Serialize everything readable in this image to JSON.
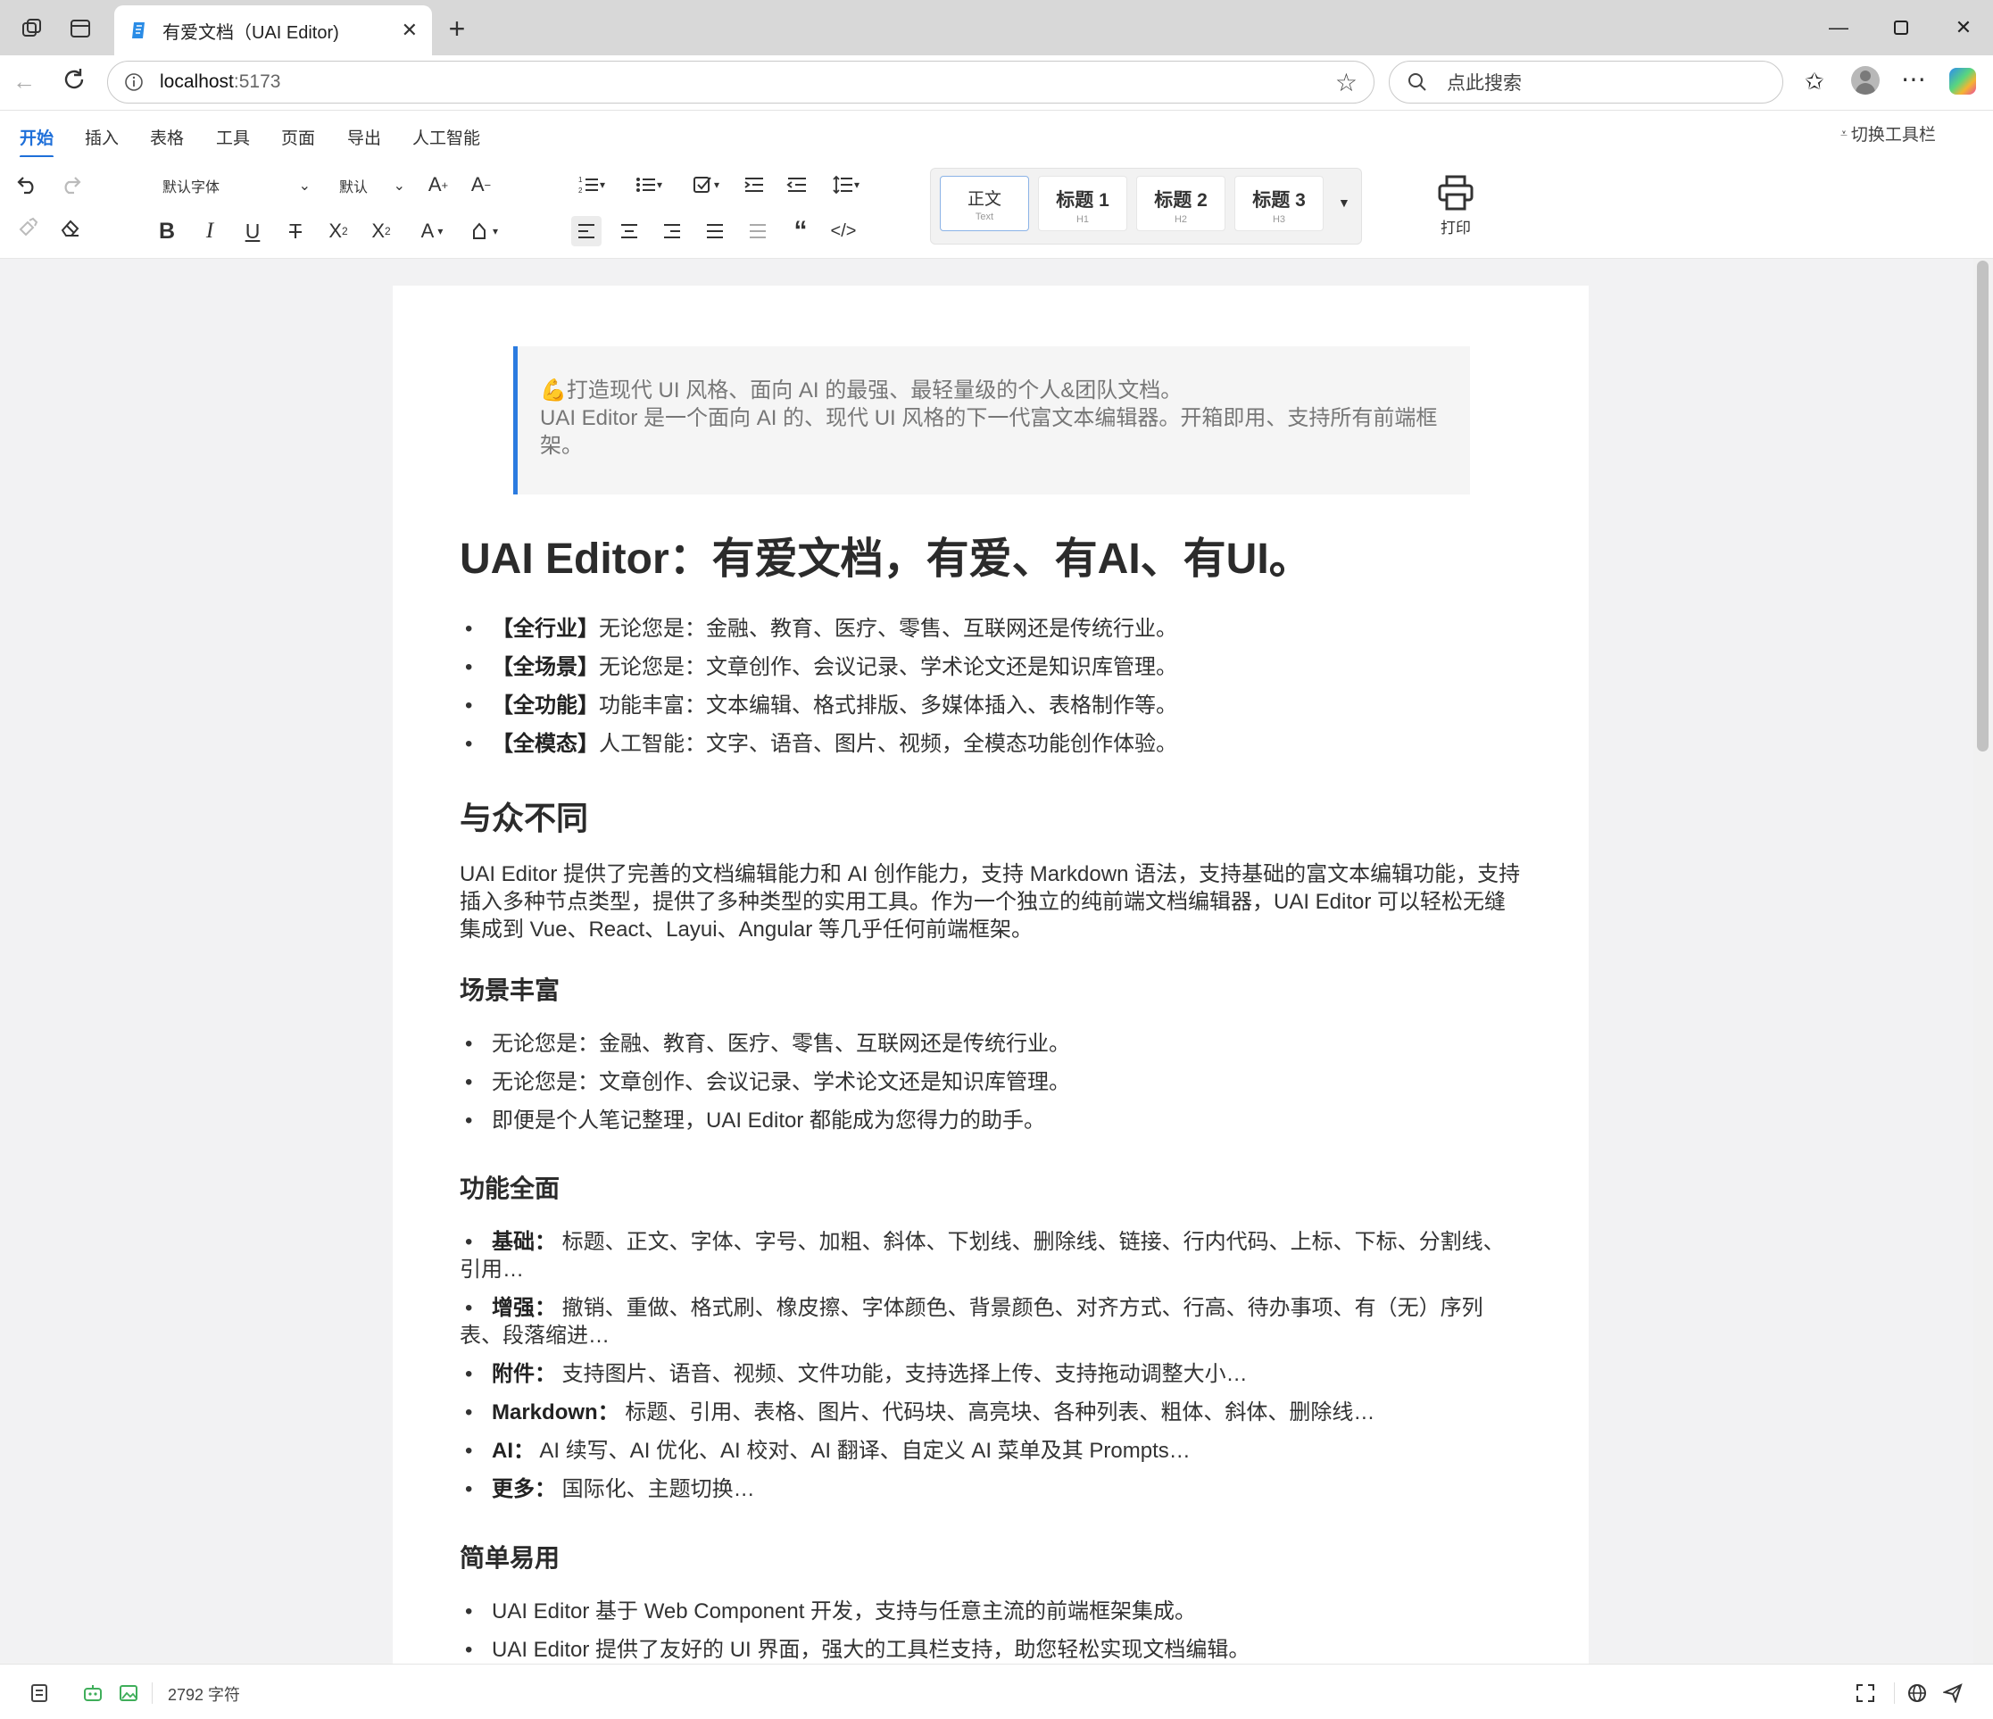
{
  "browser": {
    "tab_title": "有爱文档（UAI Editor)",
    "url_host": "localhost",
    "url_port": ":5173",
    "search_placeholder": "点此搜索",
    "new_tab": "+"
  },
  "editor": {
    "menus": [
      "开始",
      "插入",
      "表格",
      "工具",
      "页面",
      "导出",
      "人工智能"
    ],
    "toggle_toolbar": "切换工具栏",
    "font_family": "默认字体",
    "font_size": "默认",
    "headings": [
      {
        "label": "正文",
        "sub": "Text"
      },
      {
        "label": "标题 1",
        "sub": "H1"
      },
      {
        "label": "标题 2",
        "sub": "H2"
      },
      {
        "label": "标题 3",
        "sub": "H3"
      }
    ],
    "print": "打印",
    "accent": "#1e6fd9"
  },
  "doc": {
    "quote_line1": "💪打造现代 UI 风格、面向 AI 的最强、最轻量级的个人&团队文档。",
    "quote_line2": "UAI Editor 是一个面向 AI 的、现代 UI 风格的下一代富文本编辑器。开箱即用、支持所有前端框",
    "quote_line3": "架。",
    "title": "UAI Editor：有爱文档，有爱、有AI、有UI。",
    "features": [
      {
        "tag": "【全行业】",
        "text": "无论您是：金融、教育、医疗、零售、互联网还是传统行业。"
      },
      {
        "tag": "【全场景】",
        "text": "无论您是：文章创作、会议记录、学术论文还是知识库管理。"
      },
      {
        "tag": "【全功能】",
        "text": "功能丰富：文本编辑、格式排版、多媒体插入、表格制作等。"
      },
      {
        "tag": "【全模态】",
        "text": "人工智能：文字、语音、图片、视频，全模态功能创作体验。"
      }
    ],
    "h_different": "与众不同",
    "para1_l1": "UAI Editor 提供了完善的文档编辑能力和 AI 创作能力，支持 Markdown 语法，支持基础的富文本编辑功能，支持",
    "para1_l2": "插入多种节点类型，提供了多种类型的实用工具。作为一个独立的纯前端文档编辑器，UAI Editor 可以轻松无缝",
    "para1_l3": "集成到 Vue、React、Layui、Angular 等几乎任何前端框架。",
    "h_scenes": "场景丰富",
    "scenes": [
      "无论您是：金融、教育、医疗、零售、互联网还是传统行业。",
      "无论您是：文章创作、会议记录、学术论文还是知识库管理。",
      "即便是个人笔记整理，UAI Editor 都能成为您得力的助手。"
    ],
    "h_functions": "功能全面",
    "functions": [
      {
        "tag": "基础：",
        "l1": "标题、正文、字体、字号、加粗、斜体、下划线、删除线、链接、行内代码、上标、下标、分割线、",
        "l2": "引用…"
      },
      {
        "tag": "增强：",
        "l1": "撤销、重做、格式刷、橡皮擦、字体颜色、背景颜色、对齐方式、行高、待办事项、有（无）序列",
        "l2": "表、段落缩进…"
      },
      {
        "tag": "附件：",
        "l1": "支持图片、语音、视频、文件功能，支持选择上传、支持拖动调整大小…",
        "l2": ""
      },
      {
        "tag": "Markdown：",
        "l1": "标题、引用、表格、图片、代码块、高亮块、各种列表、粗体、斜体、删除线…",
        "l2": ""
      },
      {
        "tag": "AI：",
        "l1": "AI 续写、AI 优化、AI 校对、AI 翻译、自定义 AI 菜单及其 Prompts…",
        "l2": ""
      },
      {
        "tag": "更多：",
        "l1": "国际化、主题切换…",
        "l2": ""
      }
    ],
    "h_easy": "简单易用",
    "easy": [
      "UAI Editor 基于 Web Component 开发，支持与任意主流的前端框架集成。",
      "UAI Editor 提供了友好的 UI 界面，强大的工具栏支持，助您轻松实现文档编辑。"
    ]
  },
  "status": {
    "char_count": "2792 字符"
  }
}
